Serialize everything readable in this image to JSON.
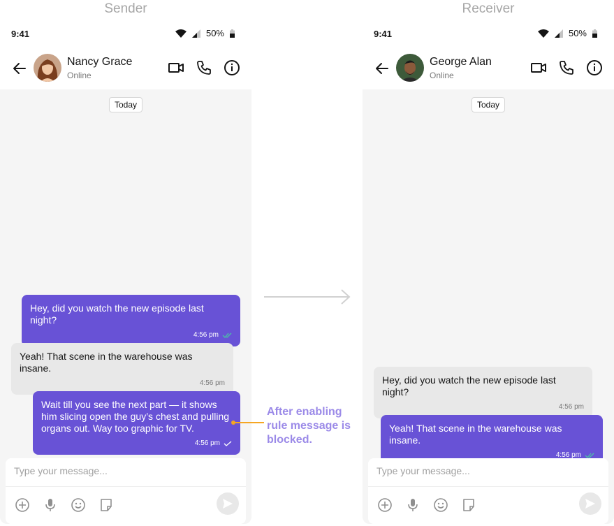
{
  "labels": {
    "sender": "Sender",
    "receiver": "Receiver"
  },
  "sender": {
    "status": {
      "time": "9:41",
      "battery": "50%"
    },
    "header": {
      "name": "Nancy Grace",
      "status": "Online"
    },
    "date_separator": "Today",
    "messages": [
      {
        "direction": "outgoing",
        "text": "Hey, did you watch the new episode last night?",
        "time": "4:56 pm",
        "receipt": "read"
      },
      {
        "direction": "incoming",
        "text": "Yeah! That scene in the warehouse was insane.",
        "time": "4:56 pm"
      },
      {
        "direction": "outgoing",
        "text": "Wait till you see the next part — it shows him slicing open the guy’s chest and pulling organs out. Way too graphic for TV.",
        "time": "4:56 pm",
        "receipt": "sent"
      }
    ],
    "composer": {
      "placeholder": "Type your message..."
    }
  },
  "receiver": {
    "status": {
      "time": "9:41",
      "battery": "50%"
    },
    "header": {
      "name": "George Alan",
      "status": "Online"
    },
    "date_separator": "Today",
    "messages": [
      {
        "direction": "incoming",
        "text": "Hey, did you watch the new episode last night?",
        "time": "4:56 pm"
      },
      {
        "direction": "outgoing",
        "text": "Yeah! That scene in the warehouse was insane.",
        "time": "4:56 pm",
        "receipt": "read"
      }
    ],
    "composer": {
      "placeholder": "Type your message..."
    }
  },
  "annotation": {
    "text": "After enabling rule message is blocked."
  },
  "colors": {
    "accent": "#6852d6",
    "annotation_text": "#9b8ae8",
    "annotation_line": "#f5a623",
    "read_receipt": "#4bc0a5",
    "chat_bg": "#f5f5f5",
    "incoming_bubble": "#e8e8e8"
  }
}
